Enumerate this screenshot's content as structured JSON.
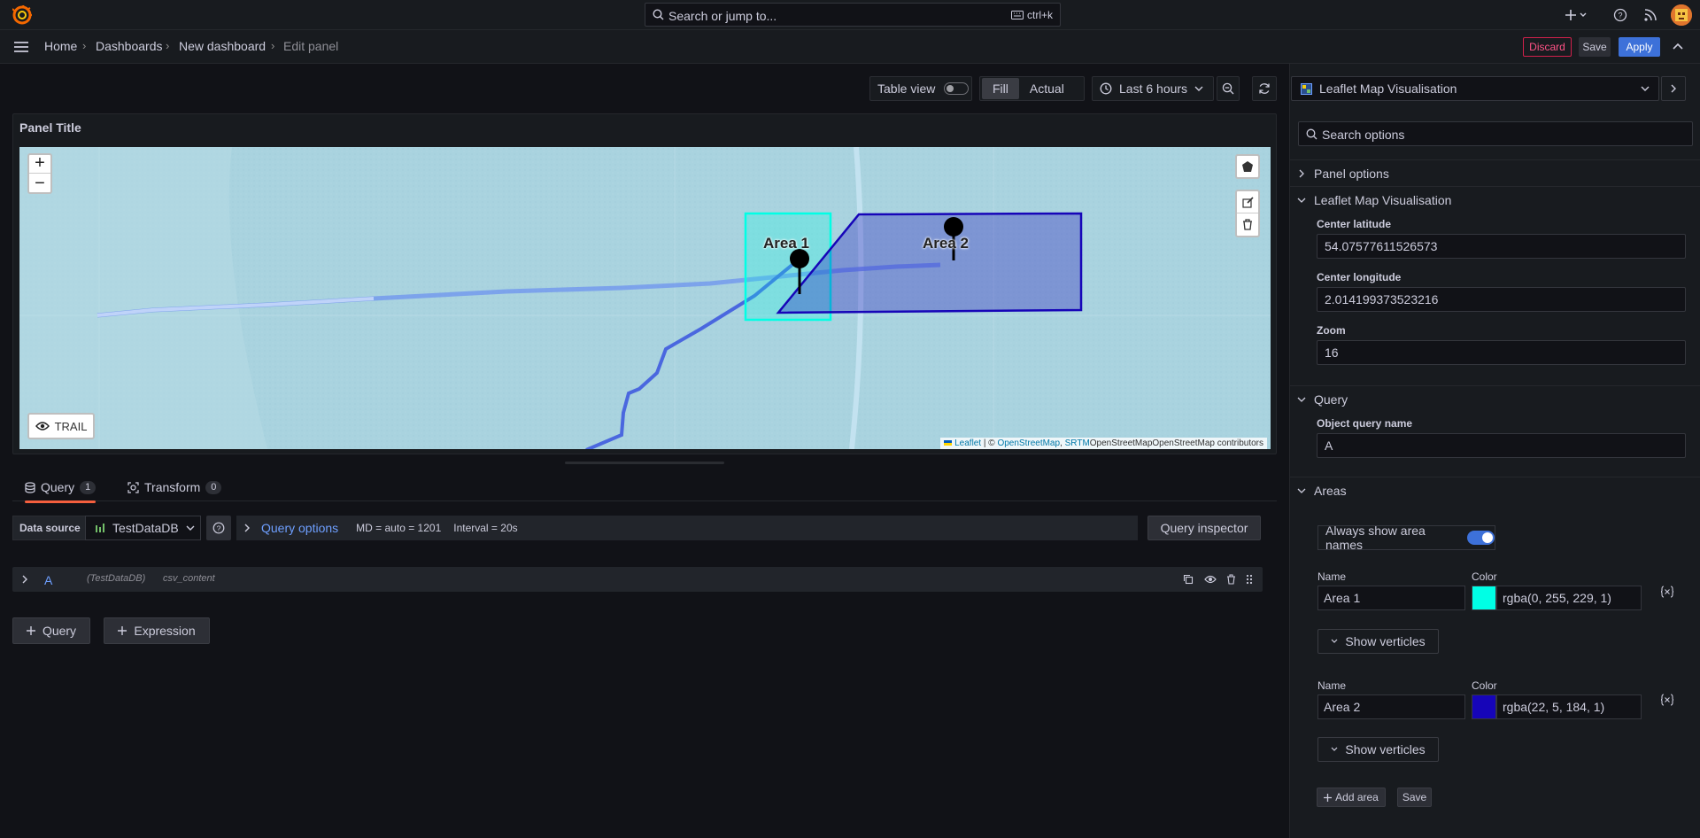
{
  "topbar": {
    "search_placeholder": "Search or jump to...",
    "search_shortcut": "ctrl+k"
  },
  "breadcrumb": [
    "Home",
    "Dashboards",
    "New dashboard",
    "Edit panel"
  ],
  "actions": {
    "discard": "Discard",
    "save": "Save",
    "apply": "Apply"
  },
  "toolbar": {
    "table_view": "Table view",
    "fill": "Fill",
    "actual": "Actual",
    "time_range": "Last 6 hours"
  },
  "panel": {
    "title": "Panel Title",
    "map": {
      "zoom_in": "+",
      "zoom_out": "−",
      "trail_button": "TRAIL",
      "area_labels": [
        "Area 1",
        "Area 2"
      ],
      "attribution": {
        "leaflet": "Leaflet",
        "sep": " | © ",
        "osm": "OpenStreetMap",
        "comma": ", ",
        "srtm": "SRTM",
        "rest": "OpenStreetMapOpenStreetMap contributors"
      }
    }
  },
  "query_tabs": [
    {
      "label": "Query",
      "count": "1"
    },
    {
      "label": "Transform",
      "count": "0"
    }
  ],
  "datasource": {
    "label": "Data source",
    "selected": "TestDataDB",
    "query_options": "Query options",
    "md": "MD = auto = 1201",
    "interval": "Interval = 20s",
    "inspector": "Query inspector"
  },
  "query": {
    "ref": "A",
    "ds": "(TestDataDB)",
    "scenario": "csv_content"
  },
  "add_buttons": {
    "query": "Query",
    "expression": "Expression"
  },
  "sidebar": {
    "viz_name": "Leaflet Map Visualisation",
    "search_placeholder": "Search options",
    "sections": {
      "panel_options": "Panel options",
      "leaflet": "Leaflet Map Visualisation",
      "query": "Query",
      "areas": "Areas"
    },
    "center_lat_label": "Center latitude",
    "center_lat": "54.07577611526573",
    "center_lng_label": "Center longitude",
    "center_lng": "2.014199373523216",
    "zoom_label": "Zoom",
    "zoom": "16",
    "object_query_label": "Object query name",
    "object_query": "A",
    "always_show_names": "Always show area names",
    "areas": [
      {
        "name_label": "Name",
        "color_label": "Color",
        "name": "Area 1",
        "color": "rgba(0, 255, 229, 1)",
        "swatch": "#00ffe5",
        "show_vertices": "Show verticles"
      },
      {
        "name_label": "Name",
        "color_label": "Color",
        "name": "Area 2",
        "color": "rgba(22, 5, 184, 1)",
        "swatch": "#1605b8",
        "show_vertices": "Show verticles"
      }
    ],
    "add_area": "Add area",
    "save": "Save"
  }
}
